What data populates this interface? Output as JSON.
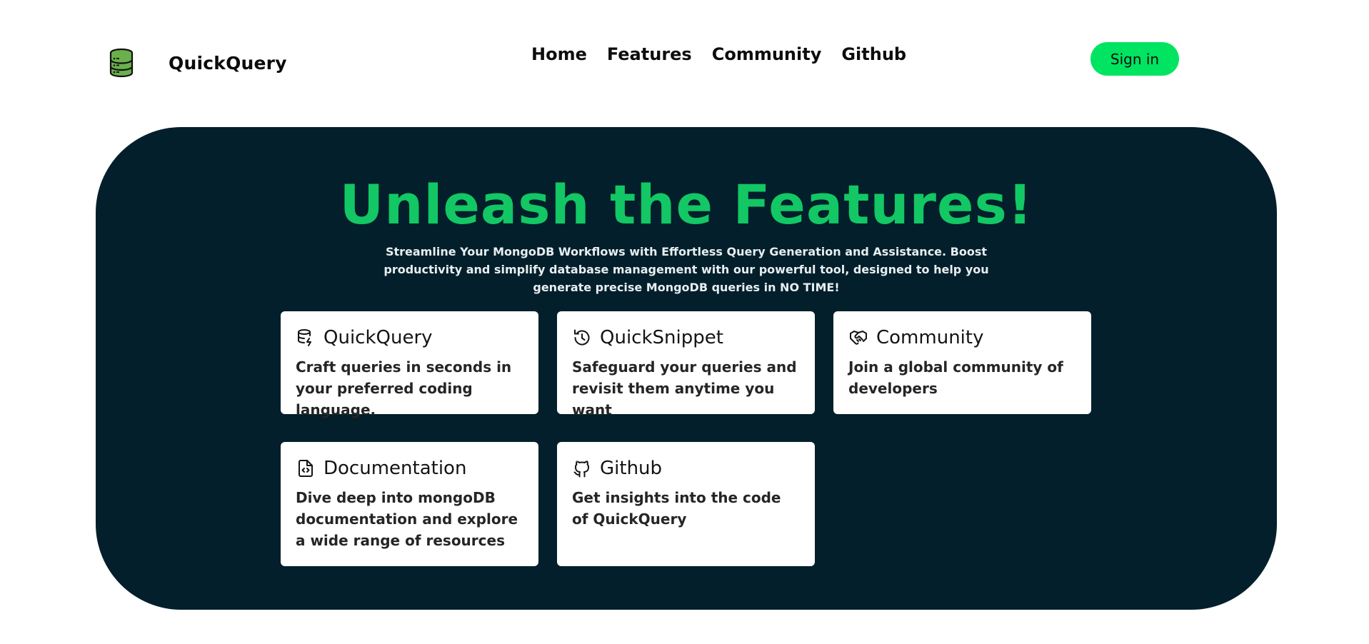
{
  "brand": {
    "name": "QuickQuery",
    "logo_icon": "database-icon",
    "logo_color": "#6ab04c"
  },
  "nav": {
    "items": [
      {
        "label": "Home"
      },
      {
        "label": "Features"
      },
      {
        "label": "Community"
      },
      {
        "label": "Github"
      }
    ]
  },
  "header": {
    "signin_label": "Sign in",
    "signin_color": "#00e461"
  },
  "hero": {
    "title": "Unleash the Features!",
    "subtitle": "Streamline Your MongoDB Workflows with Effortless Query Generation and Assistance. Boost productivity and simplify database management with our powerful tool, designed to help you generate precise MongoDB queries in NO TIME!",
    "background_color": "#021f2b",
    "title_color": "#12c764"
  },
  "features": [
    {
      "title": "QuickQuery",
      "description": "Craft queries in seconds in your preferred coding language.",
      "icon": "database-bolt-icon"
    },
    {
      "title": "QuickSnippet",
      "description": "Safeguard your queries and revisit them anytime you want",
      "icon": "history-icon"
    },
    {
      "title": "Community",
      "description": "Join a global community of developers",
      "icon": "handshake-icon"
    },
    {
      "title": "Documentation",
      "description": "Dive deep into mongoDB documentation and explore a wide range of resources",
      "icon": "file-code-icon"
    },
    {
      "title": "Github",
      "description": "Get insights into the code of QuickQuery",
      "icon": "github-icon"
    }
  ]
}
